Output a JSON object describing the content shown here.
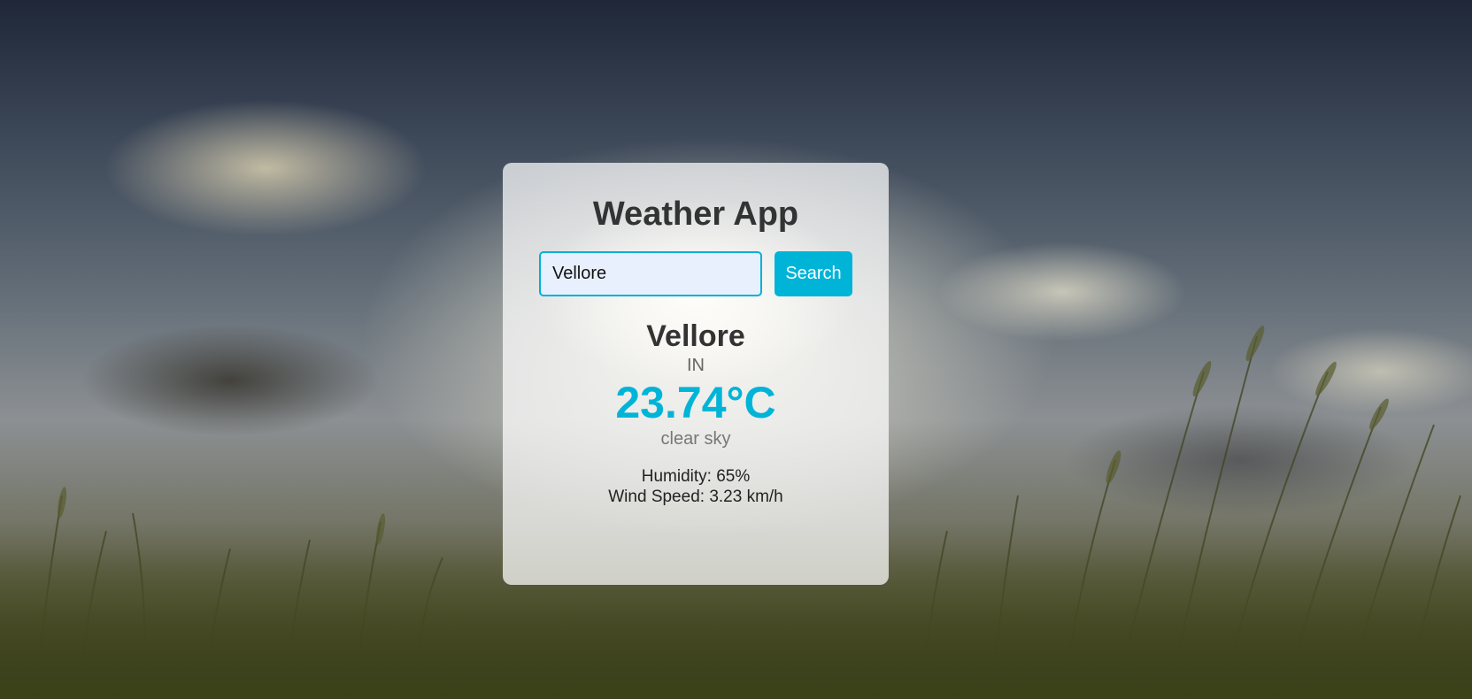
{
  "app": {
    "title": "Weather App"
  },
  "search": {
    "value": "Vellore",
    "placeholder": "",
    "button_label": "Search"
  },
  "weather": {
    "city": "Vellore",
    "country": "IN",
    "temperature": "23.74°C",
    "description": "clear sky",
    "humidity": "Humidity: 65%",
    "wind_speed": "Wind Speed: 3.23 km/h"
  },
  "colors": {
    "accent": "#00b4d8",
    "card_background": "rgba(255,255,255,0.72)",
    "text_primary": "#333333"
  }
}
